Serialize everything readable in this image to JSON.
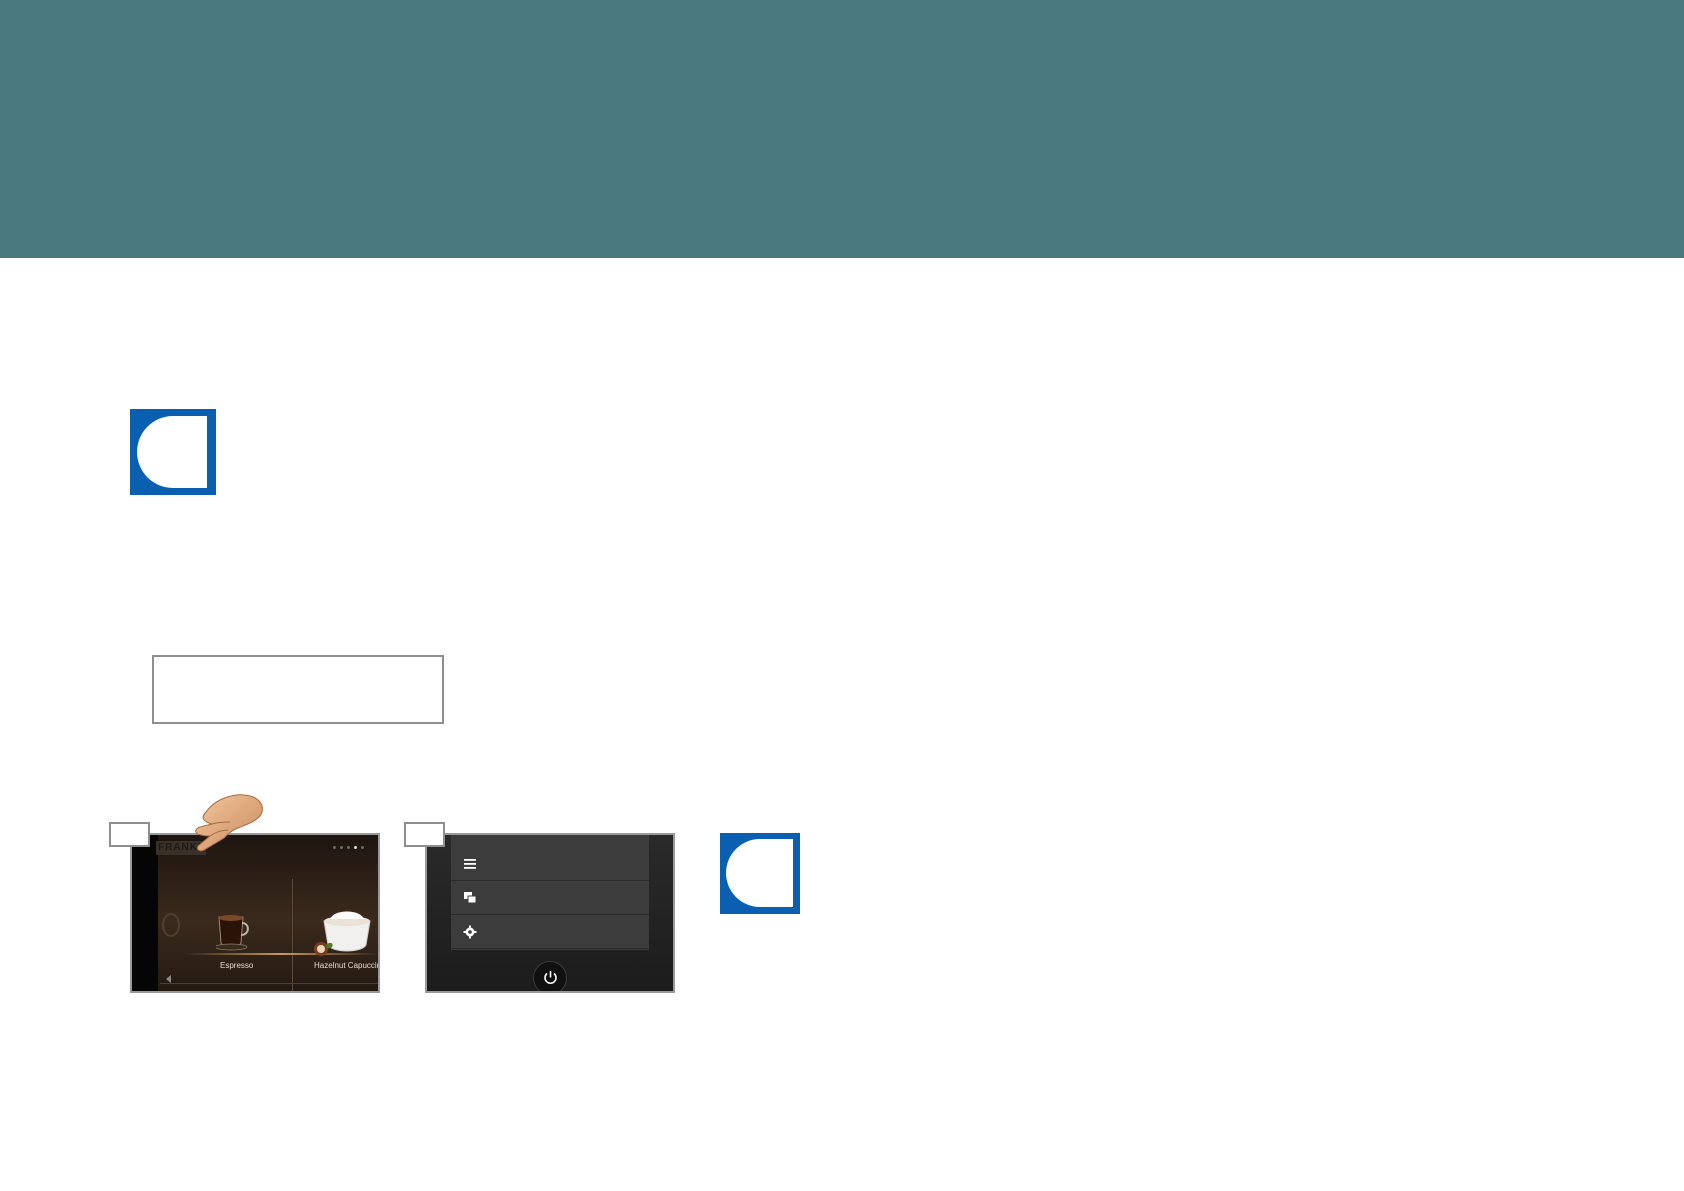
{
  "colors": {
    "header_band": "#4a7a7f",
    "info_icon": "#0b5fb0"
  },
  "icons": {
    "info_box_1": "info-icon",
    "info_box_2": "info-icon",
    "hand": "pointing-hand-icon",
    "menu_1": "list-icon",
    "menu_2": "windows-icon",
    "menu_3": "gear-icon",
    "power": "power-icon"
  },
  "screen_1": {
    "logo": "FRANKE",
    "beverages": [
      {
        "label": "Espresso"
      },
      {
        "label": "Hazelnut Capuccin"
      }
    ]
  }
}
